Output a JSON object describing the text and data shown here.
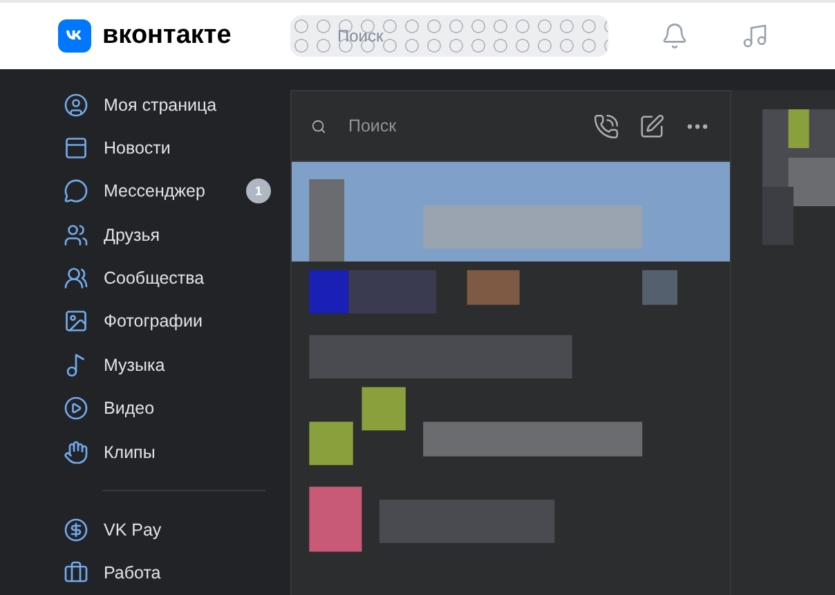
{
  "header": {
    "logo_text": "вконтакте",
    "search": {
      "placeholder": "Поиск"
    }
  },
  "sidebar": {
    "items": [
      {
        "kind": "link",
        "label": "Моя страница"
      },
      {
        "kind": "link",
        "label": "Новости"
      },
      {
        "kind": "link",
        "label": "Мессенджер",
        "badge": "1"
      },
      {
        "kind": "link",
        "label": "Друзья"
      },
      {
        "kind": "link",
        "label": "Сообщества"
      },
      {
        "kind": "link",
        "label": "Фотографии"
      },
      {
        "kind": "link",
        "label": "Музыка"
      },
      {
        "kind": "link",
        "label": "Видео"
      },
      {
        "kind": "link",
        "label": "Клипы"
      },
      {
        "kind": "divider"
      },
      {
        "kind": "link",
        "label": "VK Pay"
      },
      {
        "kind": "link",
        "label": "Работа"
      }
    ]
  },
  "messenger": {
    "search": {
      "placeholder": "Поиск"
    }
  }
}
